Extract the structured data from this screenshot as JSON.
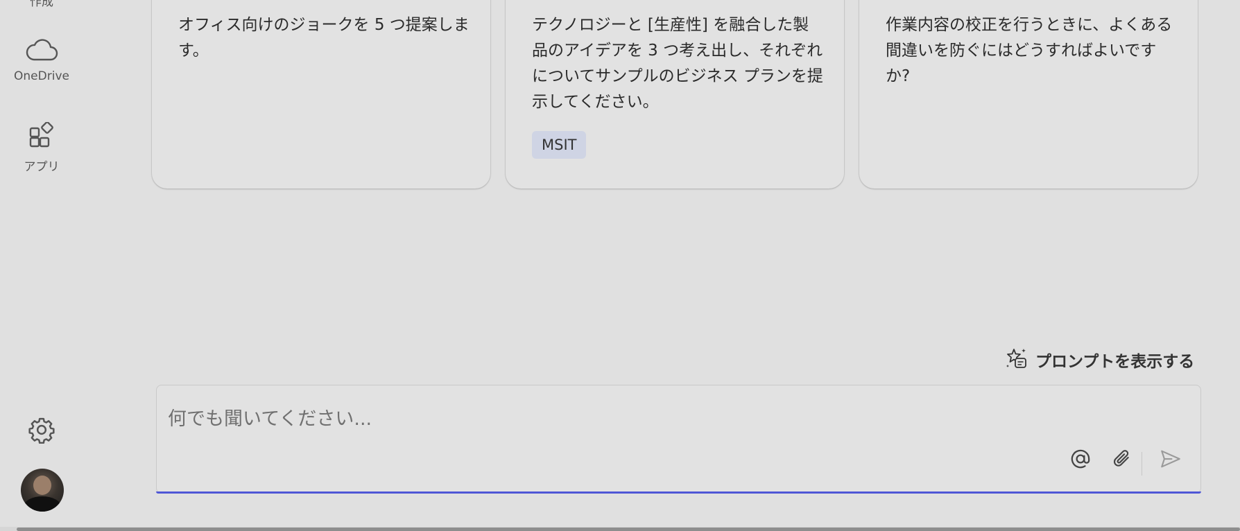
{
  "sidebar": {
    "items": [
      {
        "label": "作成",
        "icon": "create-icon"
      },
      {
        "label": "OneDrive",
        "icon": "cloud-icon"
      },
      {
        "label": "アプリ",
        "icon": "apps-icon"
      }
    ],
    "settings_icon": "gear-icon",
    "avatar_alt": "user-avatar"
  },
  "prompt_cards": [
    {
      "text": "オフィス向けのジョークを 5 つ提案します。"
    },
    {
      "text": "テクノロジーと [生産性] を融合した製品のアイデアを 3 つ考え出し、それぞれについてサンプルのビジネス プランを提示してください。",
      "tag": "MSIT"
    },
    {
      "text": "作業内容の校正を行うときに、よくある間違いを防ぐにはどうすればよいですか?"
    }
  ],
  "show_prompts": {
    "label": "プロンプトを表示する",
    "icon": "prompt-gallery-icon"
  },
  "chat": {
    "placeholder": "何でも聞いてください...",
    "mention_icon": "at-icon",
    "attach_icon": "paperclip-icon",
    "send_icon": "send-icon",
    "accent_color": "#4f57d6"
  }
}
